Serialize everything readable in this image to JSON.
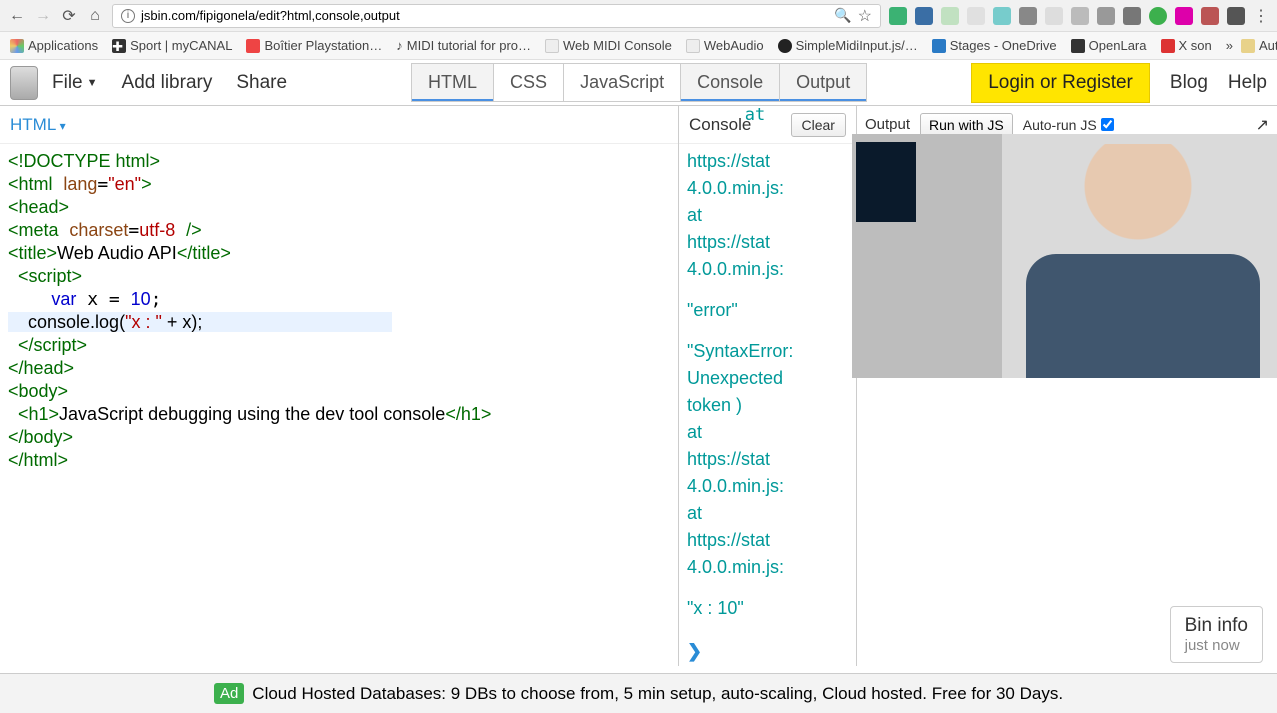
{
  "browser": {
    "url": "jsbin.com/fipigonela/edit?html,console,output"
  },
  "bookmarks": {
    "b1": "Applications",
    "b2": "Sport | myCANAL",
    "b3": "Boîtier Playstation…",
    "b4": "MIDI tutorial for pro…",
    "b5": "Web MIDI Console",
    "b6": "WebAudio",
    "b7": "SimpleMidiInput.js/…",
    "b8": "Stages - OneDrive",
    "b9": "OpenLara",
    "b10": "X son",
    "more": "»",
    "autres": "Autres favoris"
  },
  "jsbin": {
    "file": "File",
    "addlib": "Add library",
    "share": "Share",
    "tabs": {
      "html": "HTML",
      "css": "CSS",
      "js": "JavaScript",
      "console": "Console",
      "output": "Output"
    },
    "login": "Login or Register",
    "blog": "Blog",
    "help": "Help"
  },
  "panel": {
    "html_label": "HTML",
    "console_label": "Console",
    "output_label": "Output",
    "clear": "Clear",
    "run": "Run with JS",
    "autorun": "Auto-run JS"
  },
  "code": {
    "l1a": "<!DOCTYPE html>",
    "l2": "<html lang=\"en\">",
    "l3": "<head>",
    "l4": "<meta charset=utf-8 />",
    "l5a": "<title>",
    "l5b": "Web Audio API",
    "l5c": "</title>",
    "l6": "  <script>",
    "l7": "    var x = 10;",
    "l8": "    console.log(\"x : \" + x);",
    "l9": "  </script>",
    "l10": "</head>",
    "l11": "<body>",
    "l12a": "  <h1>",
    "l12b": "JavaScript debugging using the dev tool console",
    "l12c": "</h1>",
    "l13": "</body>",
    "l14": "</html>"
  },
  "console_out": {
    "frag_at": "at",
    "l1": "https://stat",
    "l2": "4.0.0.min.js:",
    "l3": "    at",
    "l4": "https://stat",
    "l5": "4.0.0.min.js:",
    "l6": "\"error\"",
    "l7": "\"SyntaxError:",
    "l8": "  Unexpected",
    "l9": "token )",
    "l10": "    at",
    "l11": "https://stat",
    "l12": "4.0.0.min.js:",
    "l13": "    at",
    "l14": "https://stat",
    "l15": "4.0.0.min.js:",
    "l16": "\"x : 10\""
  },
  "bininfo": {
    "title": "Bin info",
    "sub": "just now"
  },
  "ad": {
    "label": "Ad",
    "text": "Cloud Hosted Databases: 9 DBs to choose from, 5 min setup, auto-scaling, Cloud hosted. Free for 30 Days."
  }
}
